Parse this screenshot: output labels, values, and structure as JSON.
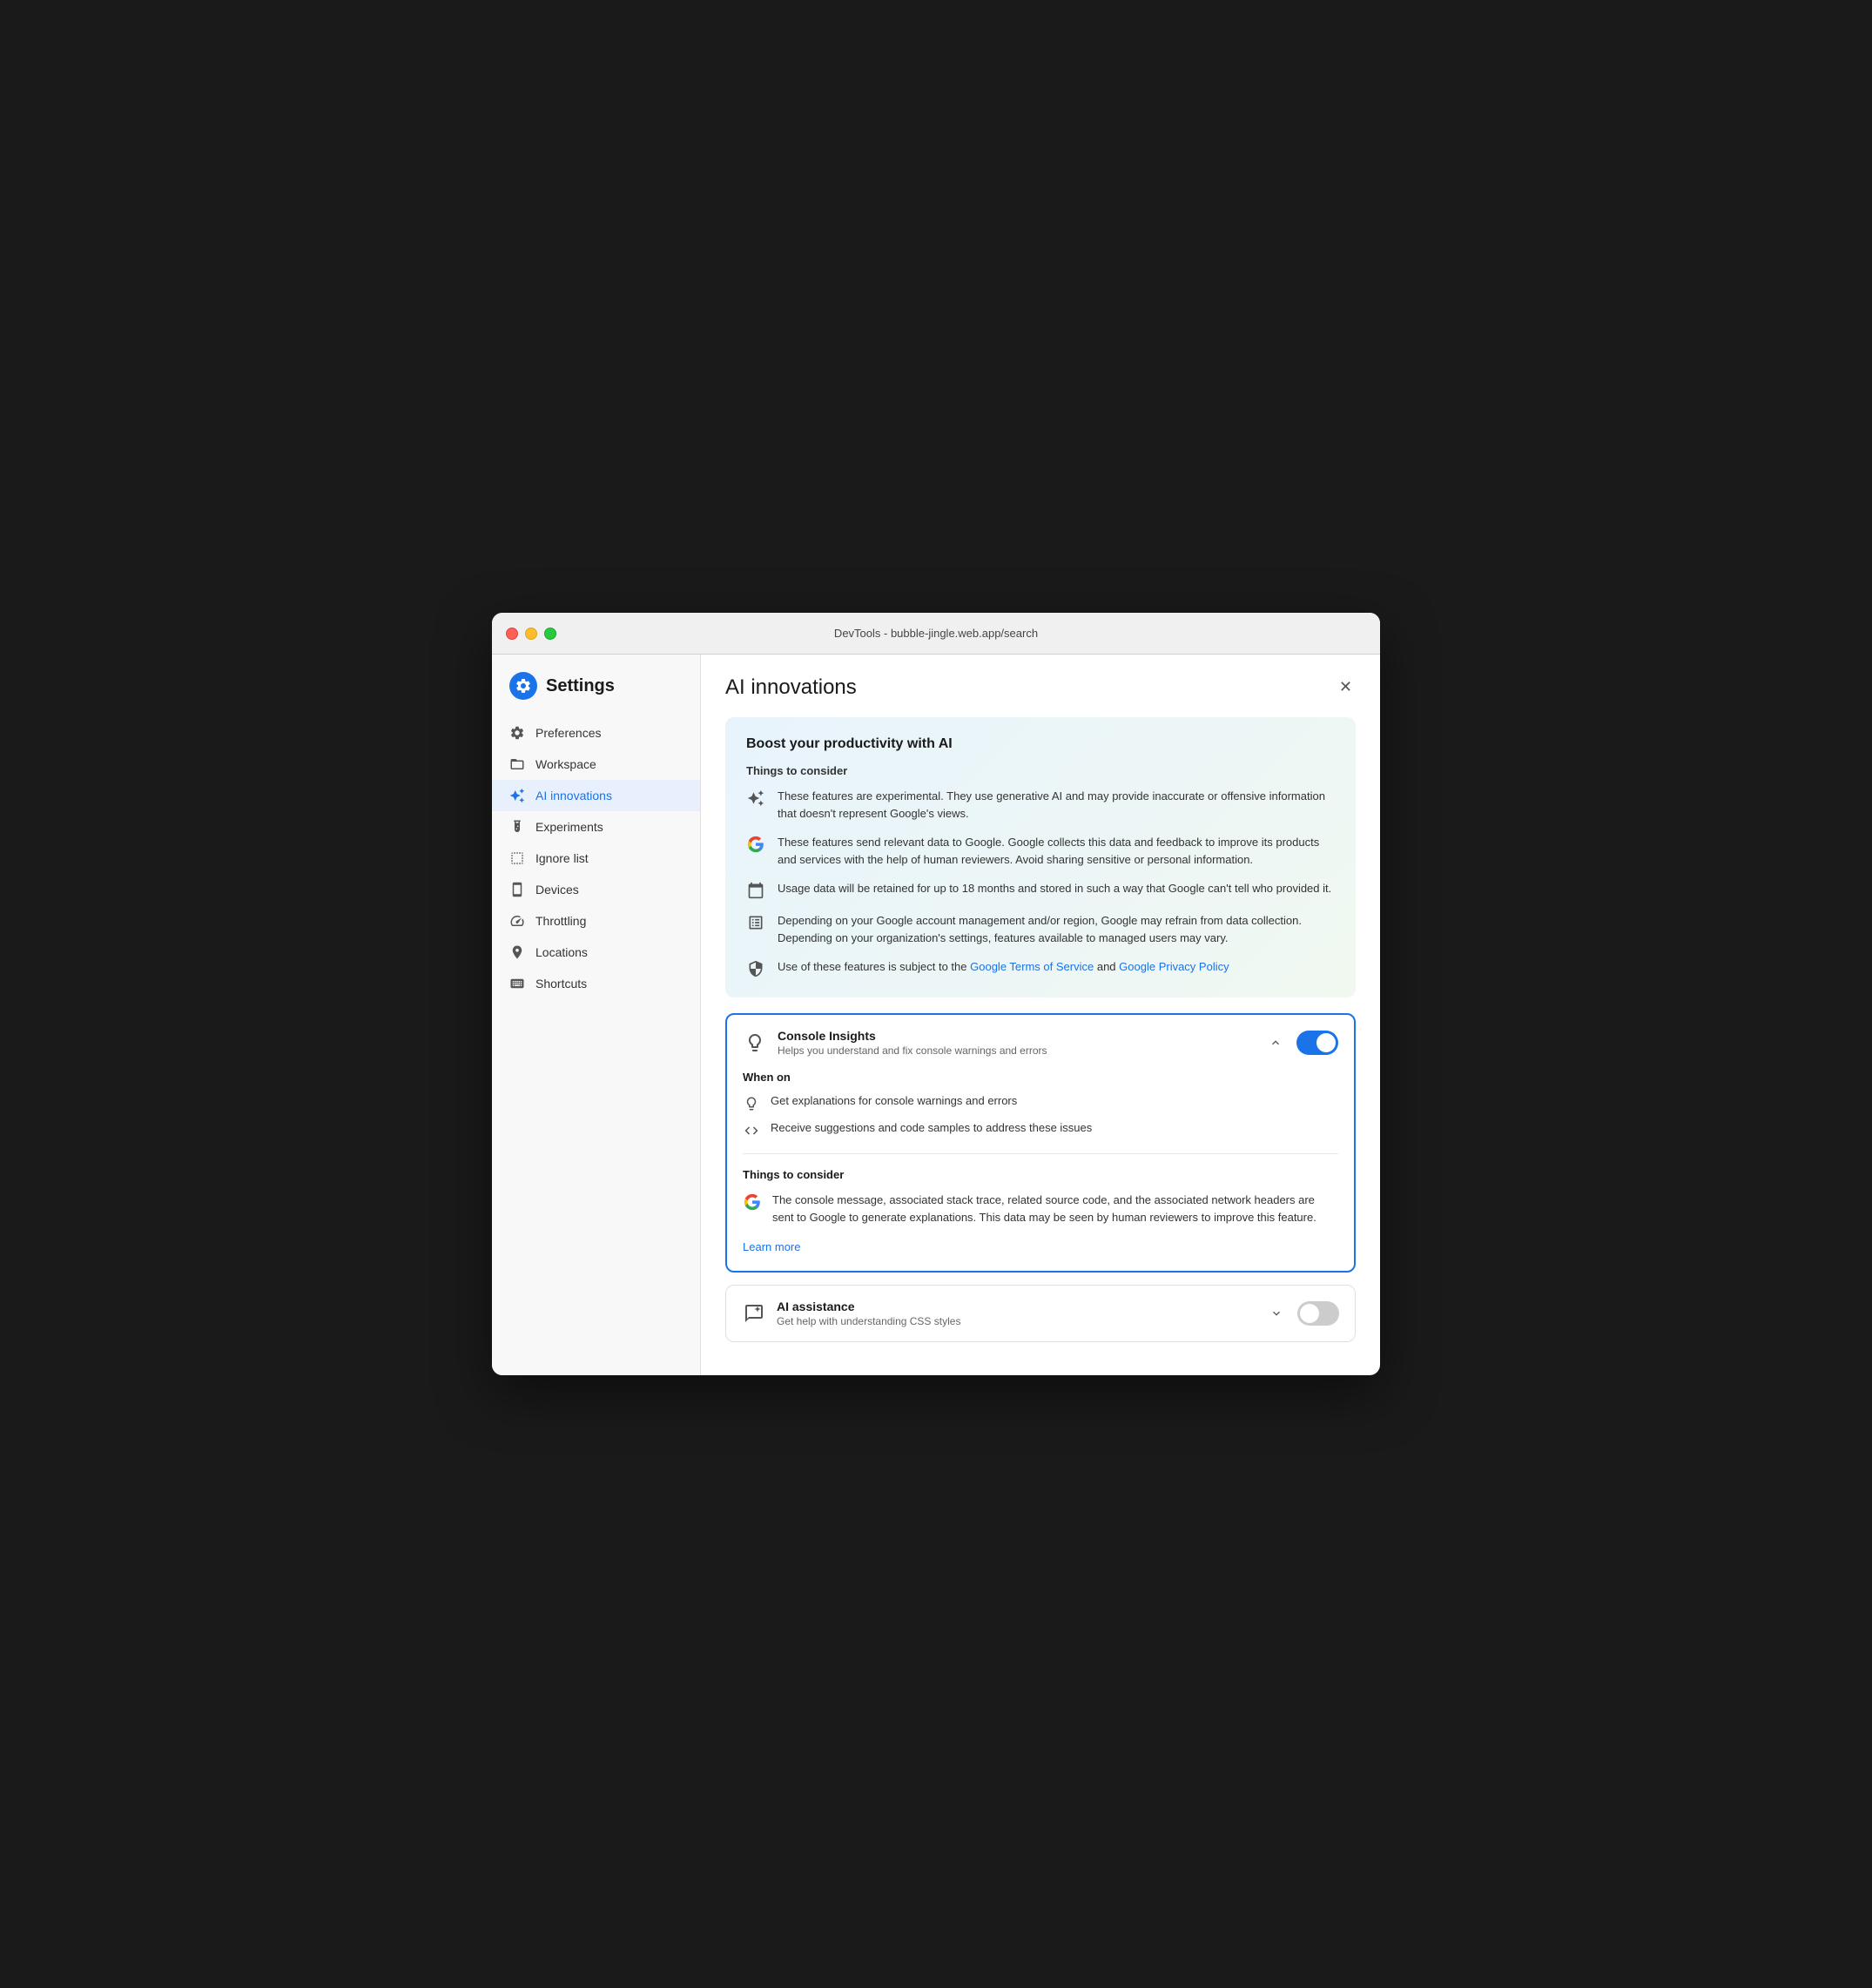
{
  "window": {
    "title": "DevTools - bubble-jingle.web.app/search"
  },
  "sidebar": {
    "header": {
      "title": "Settings"
    },
    "items": [
      {
        "id": "preferences",
        "label": "Preferences",
        "icon": "gear"
      },
      {
        "id": "workspace",
        "label": "Workspace",
        "icon": "folder"
      },
      {
        "id": "ai-innovations",
        "label": "AI innovations",
        "icon": "sparkle",
        "active": true
      },
      {
        "id": "experiments",
        "label": "Experiments",
        "icon": "beaker"
      },
      {
        "id": "ignore-list",
        "label": "Ignore list",
        "icon": "ignore"
      },
      {
        "id": "devices",
        "label": "Devices",
        "icon": "phone"
      },
      {
        "id": "throttling",
        "label": "Throttling",
        "icon": "speedometer"
      },
      {
        "id": "locations",
        "label": "Locations",
        "icon": "location"
      },
      {
        "id": "shortcuts",
        "label": "Shortcuts",
        "icon": "keyboard"
      }
    ]
  },
  "main": {
    "title": "AI innovations",
    "info_card": {
      "title": "Boost your productivity with AI",
      "things_to_consider_label": "Things to consider",
      "items": [
        {
          "icon": "sparkle-alt",
          "text": "These features are experimental. They use generative AI and may provide inaccurate or offensive information that doesn't represent Google's views."
        },
        {
          "icon": "google-g",
          "text": "These features send relevant data to Google. Google collects this data and feedback to improve its products and services with the help of human reviewers. Avoid sharing sensitive or personal information."
        },
        {
          "icon": "calendar",
          "text": "Usage data will be retained for up to 18 months and stored in such a way that Google can't tell who provided it."
        },
        {
          "icon": "list-alt",
          "text": "Depending on your Google account management and/or region, Google may refrain from data collection. Depending on your organization's settings, features available to managed users may vary."
        },
        {
          "icon": "shield",
          "text": "Use of these features is subject to the ",
          "link1_text": "Google Terms of Service",
          "link1_href": "#",
          "mid_text": " and ",
          "link2_text": "Google Privacy Policy",
          "link2_href": "#",
          "has_links": true
        }
      ]
    },
    "features": [
      {
        "id": "console-insights",
        "name": "Console Insights",
        "description": "Helps you understand and fix console warnings and errors",
        "icon": "lightbulb",
        "enabled": true,
        "expanded": true,
        "when_on": {
          "title": "When on",
          "items": [
            {
              "icon": "lightbulb",
              "text": "Get explanations for console warnings and errors"
            },
            {
              "icon": "code",
              "text": "Receive suggestions and code samples to address these issues"
            }
          ]
        },
        "things_to_consider": {
          "title": "Things to consider",
          "items": [
            {
              "icon": "google-g",
              "text": "The console message, associated stack trace, related source code, and the associated network headers are sent to Google to generate explanations. This data may be seen by human reviewers to improve this feature."
            }
          ]
        },
        "learn_more_text": "Learn more",
        "learn_more_href": "#"
      },
      {
        "id": "ai-assistance",
        "name": "AI assistance",
        "description": "Get help with understanding CSS styles",
        "icon": "chat",
        "enabled": false,
        "expanded": false
      }
    ]
  }
}
